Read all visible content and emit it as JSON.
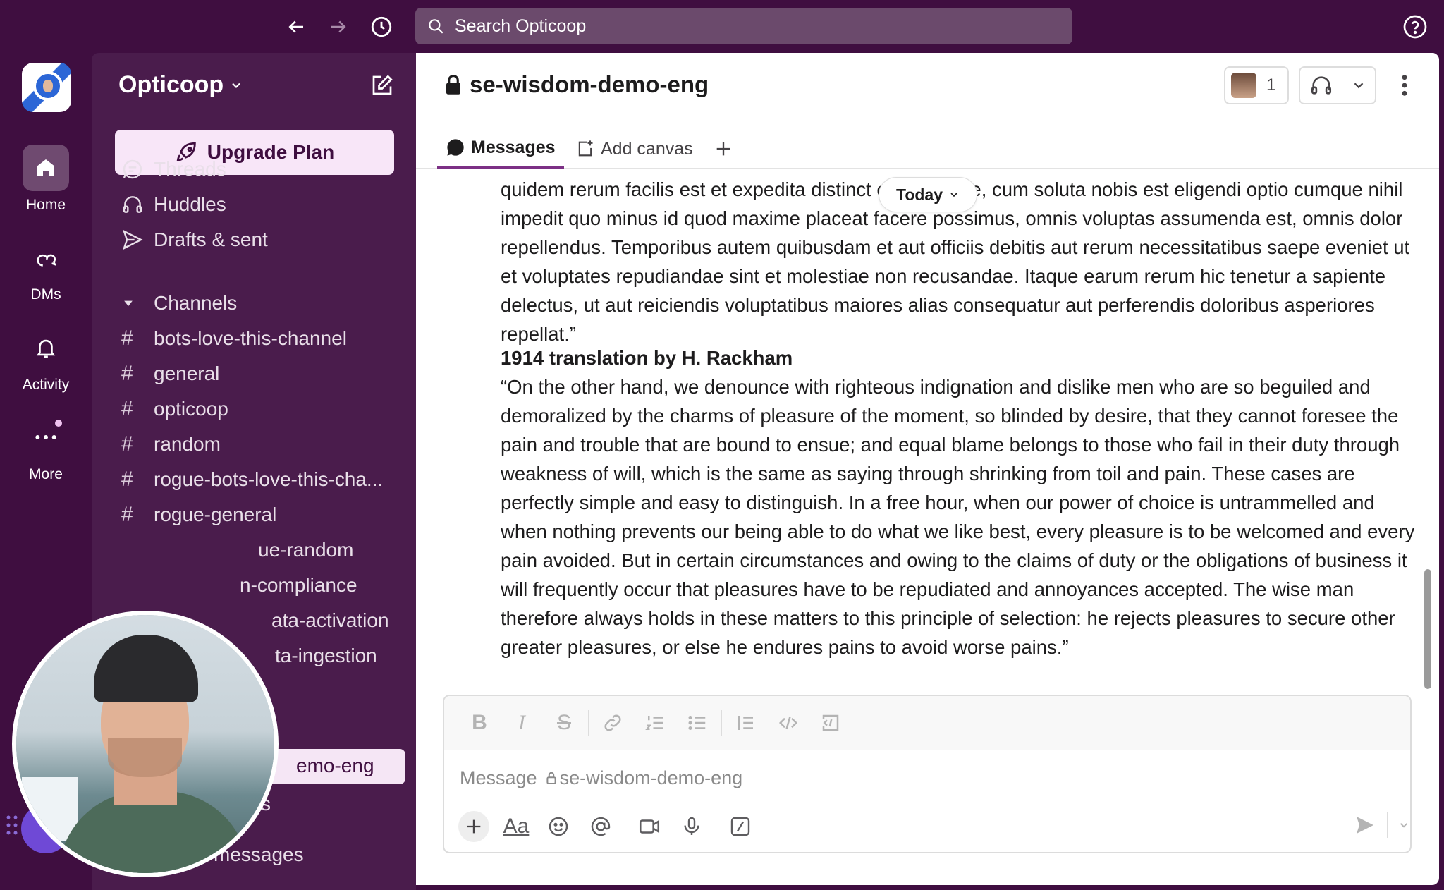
{
  "search": {
    "placeholder": "Search Opticoop"
  },
  "rail": {
    "items": [
      {
        "label": "Home",
        "icon": "home-icon"
      },
      {
        "label": "DMs",
        "icon": "dms-icon"
      },
      {
        "label": "Activity",
        "icon": "bell-icon"
      },
      {
        "label": "More",
        "icon": "more-icon"
      }
    ]
  },
  "sidebar": {
    "workspace_name": "Opticoop",
    "upgrade_label": "Upgrade Plan",
    "nav": [
      {
        "label": "Threads",
        "icon": "threads-icon"
      },
      {
        "label": "Huddles",
        "icon": "headphones-icon"
      },
      {
        "label": "Drafts & sent",
        "icon": "send-icon"
      }
    ],
    "channels_header": "Channels",
    "channels": [
      "bots-love-this-channel",
      "general",
      "opticoop",
      "random",
      "rogue-bots-love-this-cha...",
      "rogue-general",
      "ue-random",
      "n-compliance",
      "ata-activation",
      "ta-ingestion",
      "s",
      "messages"
    ],
    "active_channel_partial": "emo-eng"
  },
  "channel": {
    "name": "se-wisdom-demo-eng",
    "member_count": "1",
    "tabs": [
      {
        "label": "Messages"
      },
      {
        "label": "Add canvas"
      }
    ]
  },
  "messages": {
    "date_divider": "Today",
    "para1": "quidem rerum facilis est et expedita distinct ero tempore, cum soluta nobis est eligendi optio cumque nihil impedit quo minus id quod maxime placeat facere possimus, omnis voluptas assumenda est, omnis dolor repellendus. Temporibus autem quibusdam et aut officiis debitis aut rerum necessitatibus saepe eveniet ut et voluptates repudiandae sint et molestiae non recusandae. Itaque earum rerum hic tenetur a sapiente delectus, ut aut reiciendis voluptatibus maiores alias consequatur aut perferendis doloribus asperiores repellat.”",
    "heading": "1914 translation by H. Rackham",
    "para2": "“On the other hand, we denounce with righteous indignation and dislike men who are so beguiled and demoralized by the charms of pleasure of the moment, so blinded by desire, that they cannot foresee the pain and trouble that are bound to ensue; and equal blame belongs to those who fail in their duty through weakness of will, which is the same as saying through shrinking from toil and pain. These cases are perfectly simple and easy to distinguish. In a free hour, when our power of choice is untrammelled and when nothing prevents our being able to do what we like best, every pleasure is to be welcomed and every pain avoided. But in certain circumstances and owing to the claims of duty or the obligations of business it will frequently occur that pleasures have to be repudiated and annoyances accepted. The wise man therefore always holds in these matters to this principle of selection: he rejects pleasures to secure other greater pleasures, or else he endures pains to avoid worse pains.”"
  },
  "composer": {
    "placeholder_prefix": "Message",
    "placeholder_channel": "se-wisdom-demo-eng"
  },
  "colors": {
    "aubergine": "#3f0e40",
    "sidebar": "#4a1c4c",
    "accent": "#7c3085"
  }
}
